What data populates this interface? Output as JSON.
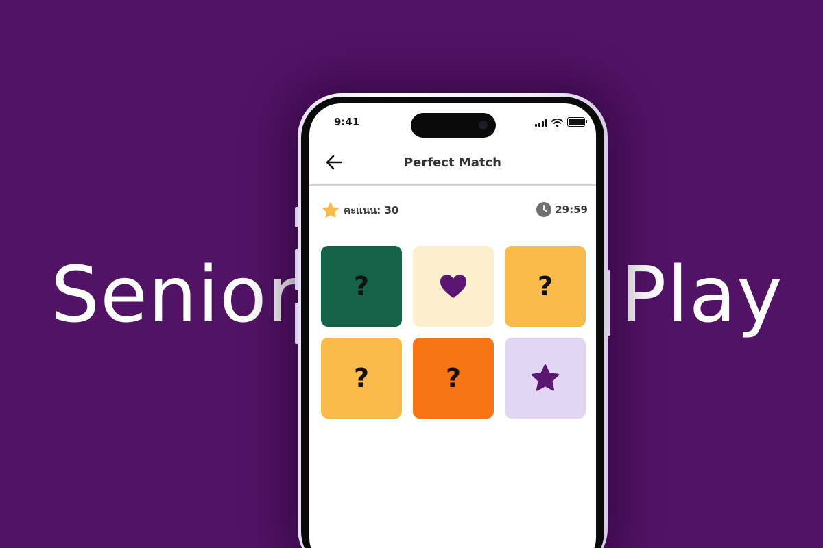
{
  "brand": {
    "left_word": "Senior",
    "right_word": "Play"
  },
  "status_bar": {
    "time": "9:41",
    "icons": [
      "signal-icon",
      "wifi-icon",
      "battery-icon"
    ]
  },
  "header": {
    "title": "Perfect Match",
    "back_icon": "arrow-left-icon"
  },
  "stats": {
    "score_label": "คะแนน: 30",
    "score_icon": "star-icon",
    "timer": "29:59",
    "timer_icon": "clock-icon"
  },
  "cards": [
    {
      "state": "hidden",
      "symbol": "?",
      "color": "#17634A"
    },
    {
      "state": "revealed",
      "icon": "heart-icon",
      "color": "#FCEFCD"
    },
    {
      "state": "hidden",
      "symbol": "?",
      "color": "#F8BA4A"
    },
    {
      "state": "hidden",
      "symbol": "?",
      "color": "#F8BA4A"
    },
    {
      "state": "hidden",
      "symbol": "?",
      "color": "#F77515"
    },
    {
      "state": "revealed",
      "icon": "star-icon",
      "color": "#E2D6F5"
    }
  ],
  "colors": {
    "background": "#521266",
    "accent_purple": "#5A1670",
    "star_yellow": "#F8BA4A",
    "clock_gray": "#6F6F6F"
  }
}
